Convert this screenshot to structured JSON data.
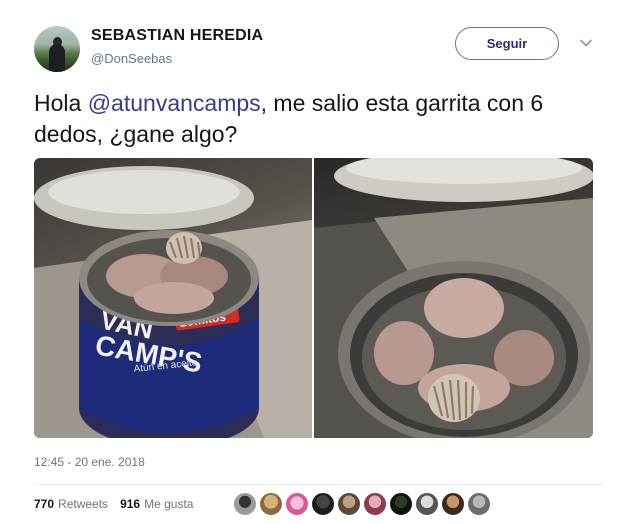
{
  "user": {
    "display_name": "SEBASTIAN HEREDIA",
    "handle": "@DonSeebas",
    "avatar_icon": "profile-photo"
  },
  "follow_button": {
    "label": "Seguir"
  },
  "menu_icon": "chevron-down-icon",
  "tweet": {
    "text_before": "Hola ",
    "mention": "@atunvancamps",
    "text_after": ", me salio esta garrita con 6 dedos, ¿gane algo?"
  },
  "photos": [
    {
      "icon": "photo-tuna-can-label",
      "label_text_1": "VAN",
      "label_text_2": "CAMP'S",
      "label_brand": "Lomitos",
      "label_small": "Atún en aceite"
    },
    {
      "icon": "photo-tuna-can-open-top"
    }
  ],
  "meta": {
    "timestamp": "12:45 - 20 ene. 2018"
  },
  "stats": {
    "retweets_count": "770",
    "retweets_label": "Retweets",
    "likes_count": "916",
    "likes_label": "Me gusta"
  },
  "likers_count": 10,
  "colors": {
    "mention": "#3b3a8f",
    "button_border": "#6c6f94",
    "secondary_text": "#657786"
  }
}
